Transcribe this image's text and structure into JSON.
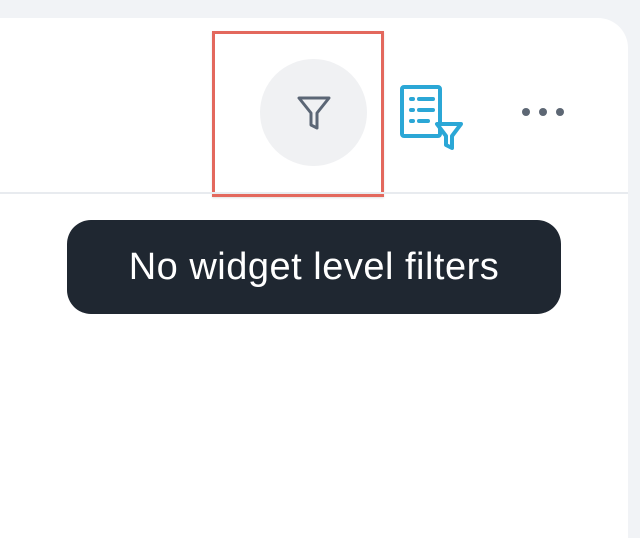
{
  "card": {
    "actions": {
      "filter_icon": "funnel-icon",
      "list_filter_icon": "list-filter-icon",
      "more_icon": "more-horizontal-icon"
    },
    "tooltip": {
      "text": "No widget level filters"
    }
  },
  "colors": {
    "page_background": "#f1f3f6",
    "card_background": "#ffffff",
    "divider": "#e8ebef",
    "filter_button_background": "#f0f1f3",
    "filter_icon": "#5b6675",
    "list_filter_icon": "#2ba7d6",
    "more_icon": "#5d6774",
    "highlight_border": "#e3685d",
    "tooltip_background": "#1f2731",
    "tooltip_text": "#ffffff"
  }
}
